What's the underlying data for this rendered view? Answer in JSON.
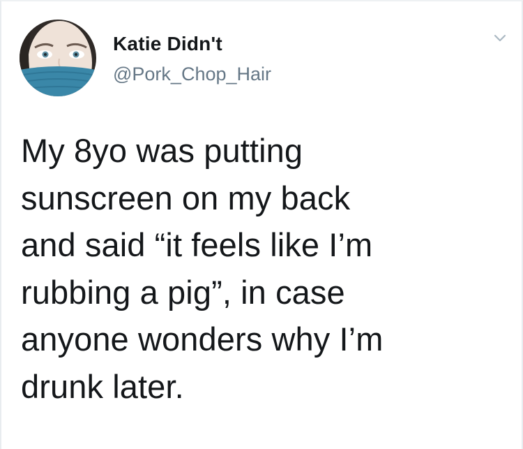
{
  "tweet": {
    "user": {
      "display_name": "Katie Didn't",
      "handle": "@Pork_Chop_Hair",
      "avatar_icon": "profile-photo"
    },
    "menu_icon": "chevron-down-icon",
    "text_lines": [
      "My 8yo was putting",
      "sunscreen on my back",
      "and said “it feels like I’m",
      "rubbing a pig”, in case",
      "anyone wonders why I’m",
      "drunk later."
    ]
  },
  "colors": {
    "text": "#14171a",
    "secondary_text": "#657786",
    "background": "#ffffff",
    "avatar_mask": "#3a87a8"
  }
}
